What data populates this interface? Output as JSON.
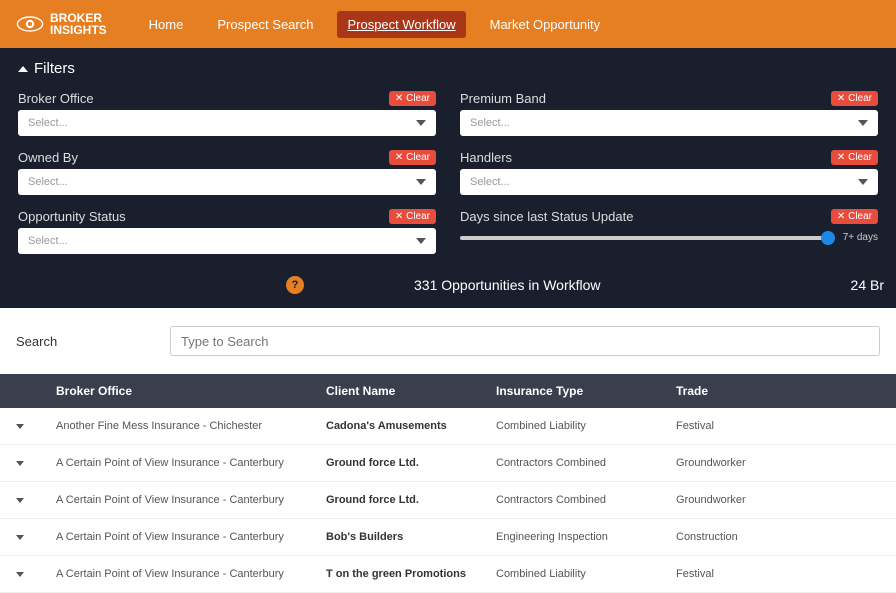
{
  "brand": {
    "line1": "BROKER",
    "line2": "INSIGHTS"
  },
  "nav": {
    "items": [
      {
        "label": "Home"
      },
      {
        "label": "Prospect Search"
      },
      {
        "label": "Prospect Workflow",
        "active": true
      },
      {
        "label": "Market Opportunity"
      }
    ]
  },
  "filters": {
    "title": "Filters",
    "clear_label": "Clear",
    "select_placeholder": "Select...",
    "broker_office": {
      "label": "Broker Office"
    },
    "premium_band": {
      "label": "Premium Band"
    },
    "owned_by": {
      "label": "Owned By"
    },
    "handlers": {
      "label": "Handlers"
    },
    "opportunity_status": {
      "label": "Opportunity Status"
    },
    "days_since": {
      "label": "Days since last Status Update",
      "value_label": "7+ days"
    }
  },
  "stats": {
    "help": "?",
    "main": "331 Opportunities in Workflow",
    "right": "24 Br"
  },
  "search": {
    "label": "Search",
    "placeholder": "Type to Search"
  },
  "table": {
    "headers": {
      "broker_office": "Broker Office",
      "client_name": "Client Name",
      "insurance_type": "Insurance Type",
      "trade": "Trade"
    },
    "rows": [
      {
        "office": "Another Fine Mess Insurance - Chichester",
        "client": "Cadona's Amusements",
        "insurance": "Combined Liability",
        "trade": "Festival"
      },
      {
        "office": "A Certain Point of View Insurance - Canterbury",
        "client": "Ground force Ltd.",
        "insurance": "Contractors Combined",
        "trade": "Groundworker"
      },
      {
        "office": "A Certain Point of View Insurance - Canterbury",
        "client": "Ground force Ltd.",
        "insurance": "Contractors Combined",
        "trade": "Groundworker"
      },
      {
        "office": "A Certain Point of View Insurance - Canterbury",
        "client": "Bob's Builders",
        "insurance": "Engineering Inspection",
        "trade": "Construction"
      },
      {
        "office": "A Certain Point of View Insurance - Canterbury",
        "client": "T on the green Promotions",
        "insurance": "Combined Liability",
        "trade": "Festival"
      }
    ]
  }
}
